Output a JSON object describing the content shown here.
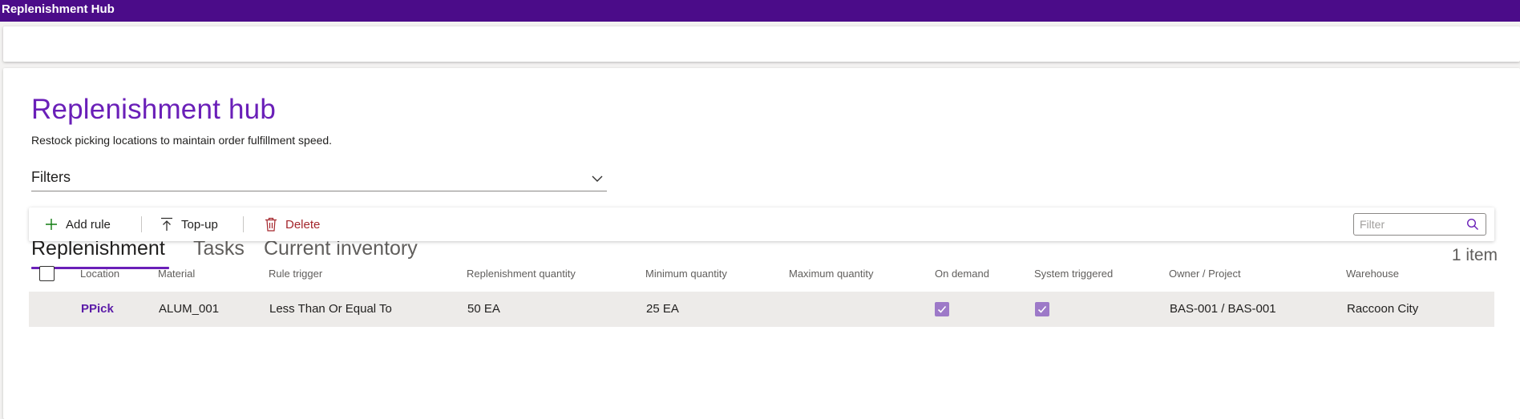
{
  "app": {
    "title": "Replenishment Hub"
  },
  "page": {
    "title": "Replenishment hub",
    "subtitle": "Restock picking locations to maintain order fulfillment speed."
  },
  "filters": {
    "label": "Filters",
    "icon": "chevron-down-icon"
  },
  "tabs": [
    {
      "label": "Replenishment",
      "active": true
    },
    {
      "label": "Tasks",
      "active": false
    },
    {
      "label": "Current inventory",
      "active": false
    }
  ],
  "item_count": "1 item",
  "toolbar": {
    "add_rule": "Add rule",
    "top_up": "Top-up",
    "delete": "Delete",
    "filter_placeholder": "Filter"
  },
  "table": {
    "columns": [
      "Location",
      "Material",
      "Rule trigger",
      "Replenishment quantity",
      "Minimum quantity",
      "Maximum quantity",
      "On demand",
      "System triggered",
      "Owner / Project",
      "Warehouse"
    ],
    "rows": [
      {
        "location": "PPick",
        "material": "ALUM_001",
        "rule_trigger": "Less Than Or Equal To",
        "replenishment_quantity": "50 EA",
        "minimum_quantity": "25 EA",
        "maximum_quantity": "",
        "on_demand": true,
        "system_triggered": true,
        "owner_project": "BAS-001 / BAS-001",
        "warehouse": "Raccoon City"
      }
    ]
  },
  "colors": {
    "brand": "#4b0c89",
    "accent": "#6a1fb8",
    "delete": "#a4262c",
    "checkbox_checked": "#9d79c8"
  }
}
